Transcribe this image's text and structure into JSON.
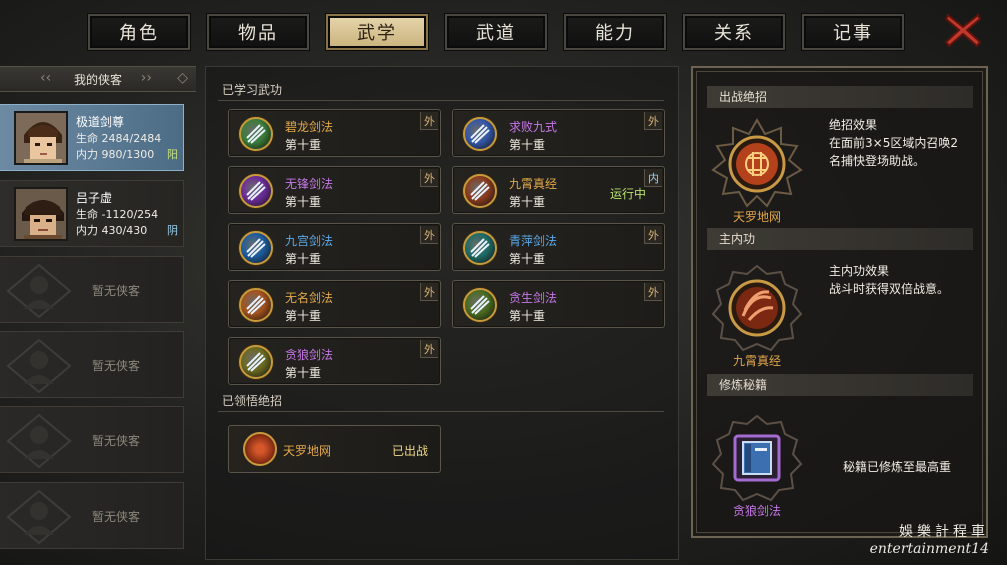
{
  "tabs": [
    "角色",
    "物品",
    "武学",
    "武道",
    "能力",
    "关系",
    "记事"
  ],
  "active_tab": "武学",
  "roster": {
    "title": "我的侠客",
    "heroes": [
      {
        "name": "极道剑尊",
        "hp_label": "生命",
        "hp": "2484/2484",
        "mp_label": "内力",
        "mp": "980/1300",
        "tag": "阳",
        "selected": true
      },
      {
        "name": "吕子虚",
        "hp_label": "生命",
        "hp": "-1120/254",
        "mp_label": "内力",
        "mp": "430/430",
        "tag": "阴",
        "selected": false
      }
    ],
    "empty_label": "暂无侠客"
  },
  "learned": {
    "title": "已学习武功",
    "skills": [
      {
        "name": "碧龙剑法",
        "level": "第十重",
        "badge": "外",
        "color": "#e2a94a",
        "icon": "sword-green-icon",
        "icon_bg": "#3b7d3a"
      },
      {
        "name": "求败九式",
        "level": "第十重",
        "badge": "外",
        "color": "#c777e8",
        "icon": "sword-blue-icon",
        "icon_bg": "#3457a8"
      },
      {
        "name": "无锋剑法",
        "level": "第十重",
        "badge": "外",
        "color": "#c777e8",
        "icon": "sword-purple-icon",
        "icon_bg": "#6b2c9a"
      },
      {
        "name": "九霄真经",
        "level": "第十重",
        "badge": "内",
        "color": "#e2a94a",
        "icon": "palm-red-icon",
        "icon_bg": "#8a3b1e",
        "status": "运行中"
      },
      {
        "name": "九宫剑法",
        "level": "第十重",
        "badge": "外",
        "color": "#5aa8e8",
        "icon": "sword-cyan-icon",
        "icon_bg": "#1d5c9e"
      },
      {
        "name": "青萍剑法",
        "level": "第十重",
        "badge": "外",
        "color": "#5aa8e8",
        "icon": "sword-teal-icon",
        "icon_bg": "#1f6b66"
      },
      {
        "name": "无名剑法",
        "level": "第十重",
        "badge": "外",
        "color": "#e2a94a",
        "icon": "sword-orange-icon",
        "icon_bg": "#a5521d"
      },
      {
        "name": "贪生剑法",
        "level": "第十重",
        "badge": "外",
        "color": "#c777e8",
        "icon": "sword-lime-icon",
        "icon_bg": "#4a6b1f"
      },
      {
        "name": "贪狼剑法",
        "level": "第十重",
        "badge": "外",
        "color": "#c777e8",
        "icon": "sword-gold-icon",
        "icon_bg": "#6b6a1f"
      }
    ]
  },
  "ultimates": {
    "title": "已领悟绝招",
    "items": [
      {
        "name": "天罗地网",
        "status": "已出战"
      }
    ]
  },
  "right": {
    "battle_title": "出战绝招",
    "battle_medal": "天罗地网",
    "battle_effect_title": "绝招效果",
    "battle_effect": "在面前3×5区域内召唤2名捕快登场助战。",
    "inner_title": "主内功",
    "inner_medal": "九霄真经",
    "inner_effect_title": "主内功效果",
    "inner_effect": "战斗时获得双倍战意。",
    "manual_title": "修炼秘籍",
    "manual_medal": "贪狼剑法",
    "manual_status": "秘籍已修炼至最高重"
  },
  "watermark": {
    "cn": "娛樂計程車",
    "en": "entertainment14"
  }
}
